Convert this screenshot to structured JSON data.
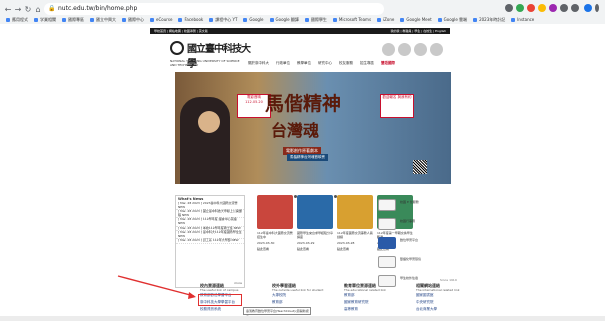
{
  "browser": {
    "url": "nutc.edu.tw/bin/home.php",
    "bookmarks": [
      "應用程式",
      "学業相關",
      "國際專區",
      "國立中興大",
      "國際中心",
      "eCourse",
      "Facebook",
      "課程中心 YT",
      "Google",
      "Google 翻譯",
      "國際學生",
      "Microsoft Teams",
      "iZone",
      "Google Meet",
      "Google 雲端",
      "2023年時計記",
      "Instance"
    ]
  },
  "site": {
    "topbar_left": "學校首頁 | 網站地圖 | 校園導覽 | 英文版",
    "topbar_right": "我的我 | 教職員 | 學生 | 在校生 | English",
    "logo_cn": "國立臺中科技大學",
    "logo_en": "NATIONAL TAICHUNG UNIVERSITY OF SCIENCE AND TECHNOLOGY",
    "nav": [
      "關於臺中科大",
      "行政單位",
      "教學單位",
      "研究中心",
      "校友服務",
      "招生專區",
      "雙語國際"
    ],
    "hero": {
      "title_line1": "馬偕精神",
      "title_line2": "台灣魂",
      "sub1": "電影創作原著劇本",
      "sub2": "馬偕精神台灣魂首映會",
      "badge1": "電影首映 112.05.20",
      "badge2": "歡迎報名 與我有約"
    },
    "news": {
      "header": "What's News",
      "items": [
        "[ Mar. 28 2023 ] 2023臺中科大國際交流營 NEW",
        "[ Mar. 28 2023 ] 國立臺中科技大學線上公開課程 NEW",
        "[ Mar. 28 2023 ] 112學年度 語言中心英語 NEW",
        "[ Mar. 28 2023 ] 本校112學年度碩士班 NEW",
        "[ Mar. 28 2023 ] 臺中科大112年度國際學位生 NEW",
        "[ Mar. 28 2023 ] 資工系 112年大學部 NEW"
      ],
      "badge_new": "NEW",
      "more": "more"
    },
    "cards": [
      {
        "text": "112年臺中科大國際交流營招生中",
        "date": "2023-03-30",
        "more": "點此查看"
      },
      {
        "text": "國際學生來台求學經驗分享講座",
        "date": "2023-03-29",
        "more": "點此查看"
      },
      {
        "text": "112年度國際交流事務人員訓練",
        "date": "2023-03-28",
        "more": "點此查看"
      },
      {
        "text": "112年度第一學期交換學生甄選",
        "date": "2023-03-27",
        "more": "點此查看"
      }
    ],
    "services": [
      "校園 E 化服務",
      "校園行事曆",
      "數位學習平台",
      "雙語化學習環境",
      "學生校外住宿"
    ],
    "footer": {
      "year_note": "Since 1919",
      "cols": [
        {
          "title": "校內資源連結",
          "sub": "The useful link of campus",
          "links": [
            "教育部數位學習平台",
            "臺中科技大學學習平台",
            "校務資訊系統"
          ]
        },
        {
          "title": "校外學習連結",
          "sub": "The outside useful link for student",
          "links": [
            "大專校院",
            "教育部",
            "勞動部"
          ]
        },
        {
          "title": "教育單位資源連結",
          "sub": "The educational related link",
          "links": [
            "教育部",
            "國家教育研究院",
            "高等教育"
          ]
        },
        {
          "title": "相關網站連結",
          "sub": "The international related link",
          "links": [
            "國家圖書館",
            "中央研究院",
            "台北商業大學"
          ]
        }
      ],
      "tooltip": "臺灣教育數位學習平台(TeachCloud)(另開新視窗)"
    }
  },
  "annotation": {
    "color": "#e03030"
  }
}
